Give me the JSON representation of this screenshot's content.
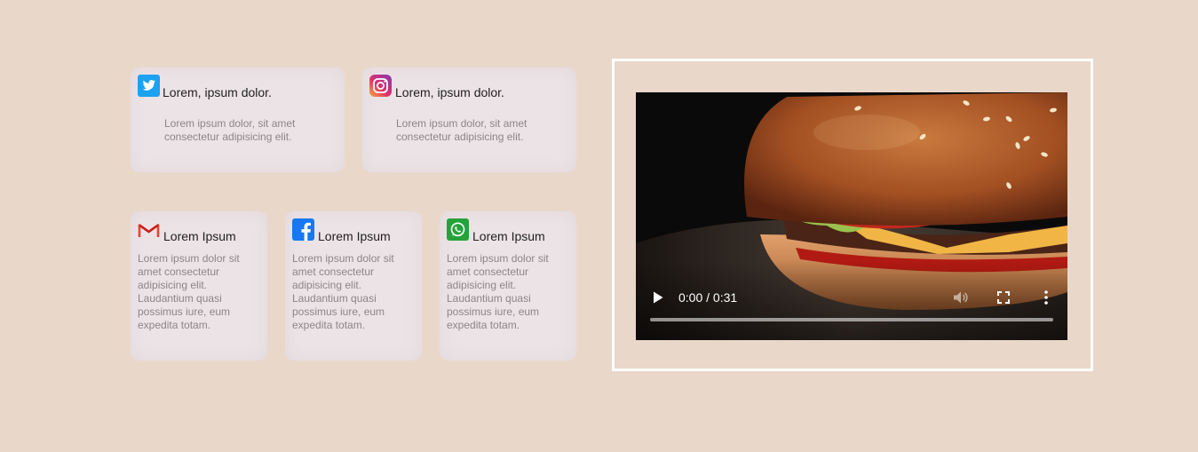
{
  "cards": [
    {
      "icon": "twitter-icon",
      "title": "Lorem, ipsum dolor.",
      "text": "Lorem ipsum dolor, sit amet consectetur adipisicing elit."
    },
    {
      "icon": "instagram-icon",
      "title": "Lorem, ipsum dolor.",
      "text": "Lorem ipsum dolor, sit amet consectetur adipisicing elit."
    },
    {
      "icon": "gmail-icon",
      "title": "Lorem Ipsum",
      "text": "Lorem ipsum dolor sit amet consectetur adipisicing elit. Laudantium quasi possimus iure, eum expedita totam."
    },
    {
      "icon": "facebook-icon",
      "title": "Lorem Ipsum",
      "text": "Lorem ipsum dolor sit amet consectetur adipisicing elit. Laudantium quasi possimus iure, eum expedita totam."
    },
    {
      "icon": "whatsapp-icon",
      "title": "Lorem Ipsum",
      "text": "Lorem ipsum dolor sit amet consectetur adipisicing elit. Laudantium quasi possimus iure, eum expedita totam."
    }
  ],
  "video": {
    "time": "0:00 / 0:31",
    "progress": 0,
    "controls": [
      "play-icon",
      "volume-icon",
      "fullscreen-icon",
      "more-icon"
    ]
  },
  "colors": {
    "background": "#e9d7ca",
    "card": "#ece3e6",
    "frame": "#ffffff",
    "twitter": "#1da1f2",
    "facebook": "#1877f2",
    "whatsapp": "#25a33a",
    "gmail": "#ea4335"
  }
}
